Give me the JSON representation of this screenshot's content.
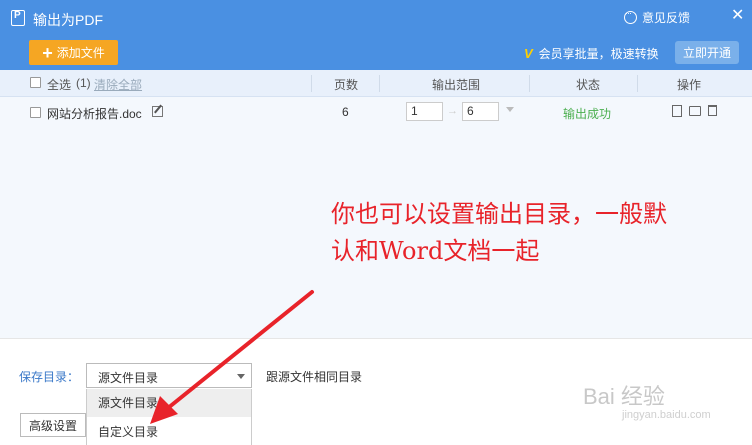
{
  "window": {
    "title": "输出为PDF",
    "feedback_label": "意见反馈",
    "close_glyph": "✕"
  },
  "toolbar": {
    "add_file_label": "添加文件",
    "vip_text": "会员享批量，极速转换",
    "open_button_label": "立即开通"
  },
  "table": {
    "headers": {
      "select_all": "全选",
      "count": "(1)",
      "clear_all": "清除全部",
      "pages": "页数",
      "range": "输出范围",
      "status": "状态",
      "actions": "操作"
    },
    "rows": [
      {
        "filename": "网站分析报告.doc",
        "pages": "6",
        "range_from": "1",
        "range_to": "6",
        "status": "输出成功"
      }
    ]
  },
  "annotation": {
    "line1": "你也可以设置输出目录，一般默",
    "line2": "认和Word文档一起"
  },
  "output": {
    "label": "保存目录：",
    "selected": "源文件目录",
    "hint": "跟源文件相同目录",
    "options": [
      "源文件目录",
      "自定义目录"
    ],
    "advanced_label": "高级设置"
  },
  "watermark": {
    "main": "Bai 经验",
    "sub": "jingyan.baidu.com"
  },
  "colors": {
    "accent": "#4a90e2",
    "add_button": "#f5a623",
    "success": "#4caf50",
    "annotation": "#e8232a"
  }
}
